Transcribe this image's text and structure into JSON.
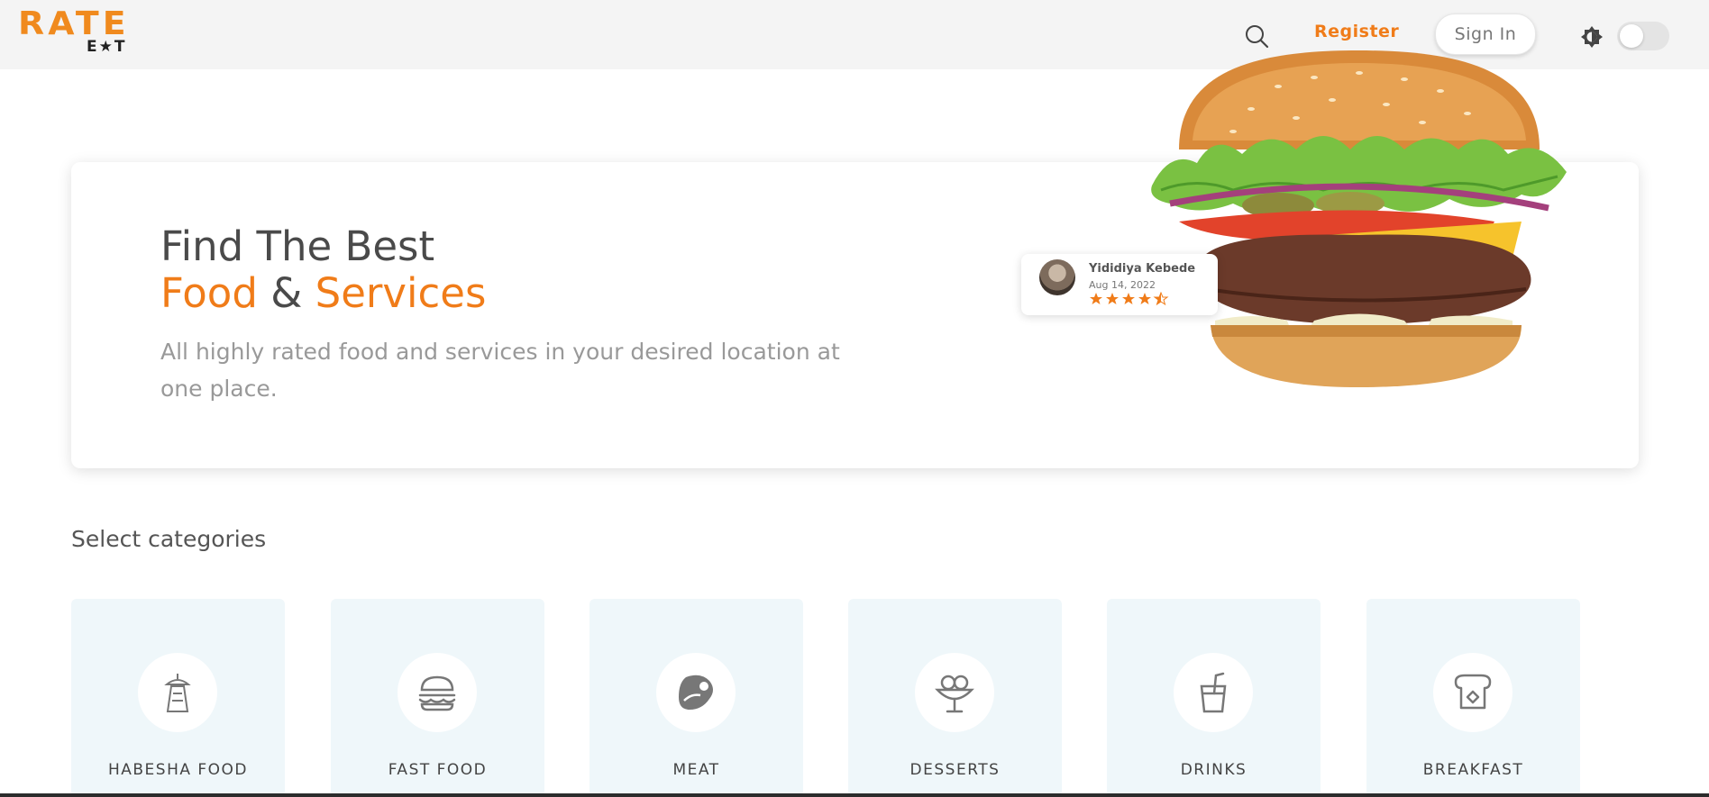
{
  "brand": {
    "logo_word": "RATE",
    "logo_sub": "E★T",
    "accent_color": "#f07c19"
  },
  "nav": {
    "search_icon": "search-icon",
    "register_label": "Register",
    "signin_label": "Sign In",
    "theme_icon": "brightness-icon",
    "dark_mode_on": false
  },
  "hero": {
    "title_line1": "Find The Best",
    "title_word1": "Food",
    "title_amp": "&",
    "title_word2": "Services",
    "description": "All highly rated food and services in your desired location at one place."
  },
  "review": {
    "name": "Yididiya Kebede",
    "date": "Aug 14, 2022",
    "rating": 4.5
  },
  "categories": {
    "heading": "Select categories",
    "items": [
      {
        "label": "HABESHA FOOD",
        "icon": "jebena-icon"
      },
      {
        "label": "FAST FOOD",
        "icon": "burger-icon"
      },
      {
        "label": "MEAT",
        "icon": "steak-icon"
      },
      {
        "label": "DESSERTS",
        "icon": "ice-cream-icon"
      },
      {
        "label": "DRINKS",
        "icon": "cup-straw-icon"
      },
      {
        "label": "BREAKFAST",
        "icon": "toast-icon"
      }
    ]
  }
}
